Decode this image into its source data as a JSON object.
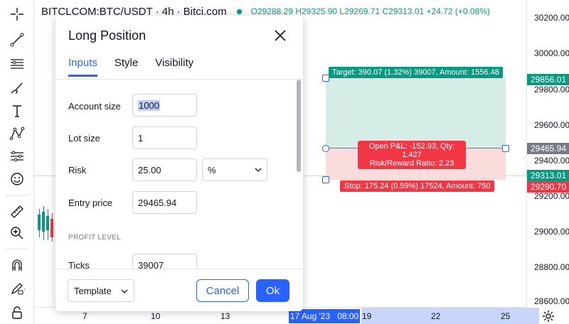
{
  "topbar": {
    "symbol": "BITCLCOM:BTC/USDT · 4h · Bitci.com",
    "open": "O29288.29",
    "high": "H29325.90",
    "low": "L29269.71",
    "close": "C29313.01",
    "change": "+24.72 (+0.08%)"
  },
  "price_axis": {
    "ticks": [
      "30200.00",
      "30000.00",
      "29800.00",
      "29600.00",
      "29400.00",
      "29200.00",
      "29000.00",
      "28800.00",
      "28600.00"
    ],
    "tags": {
      "target": "29856.01",
      "entry": "29465.94",
      "current": "29313.01",
      "stop": "29290.70"
    }
  },
  "time_axis": {
    "ticks": [
      "7",
      "10",
      "13",
      "19",
      "22",
      "25"
    ],
    "selected_date": "17 Aug '23",
    "selected_time": "08:00"
  },
  "position": {
    "target_label": "Target: 390.07 (1.32%) 39007, Amount: 1556.48",
    "pnl_line1": "Open P&L: -152.93, Qty: 1.427",
    "pnl_line2": "Risk/Reward Ratio: 2.23",
    "stop_label": "Stop: 175.24 (0.59%) 17524, Amount: 750"
  },
  "dialog": {
    "title": "Long Position",
    "tabs": [
      "Inputs",
      "Style",
      "Visibility"
    ],
    "fields": {
      "account_size_label": "Account size",
      "account_size_value": "1000",
      "lot_size_label": "Lot size",
      "lot_size_value": "1",
      "risk_label": "Risk",
      "risk_value": "25.00",
      "risk_unit": "%",
      "entry_label": "Entry price",
      "entry_value": "29465.94",
      "profit_section": "PROFIT LEVEL",
      "ticks_label": "Ticks",
      "ticks_value": "39007"
    },
    "footer": {
      "template": "Template",
      "cancel": "Cancel",
      "ok": "Ok"
    }
  },
  "colors": {
    "accent": "#2962ff",
    "profit": "#089981",
    "loss": "#f23645",
    "profit_zone": "#d5ede6",
    "loss_zone": "#fbdcdc"
  }
}
